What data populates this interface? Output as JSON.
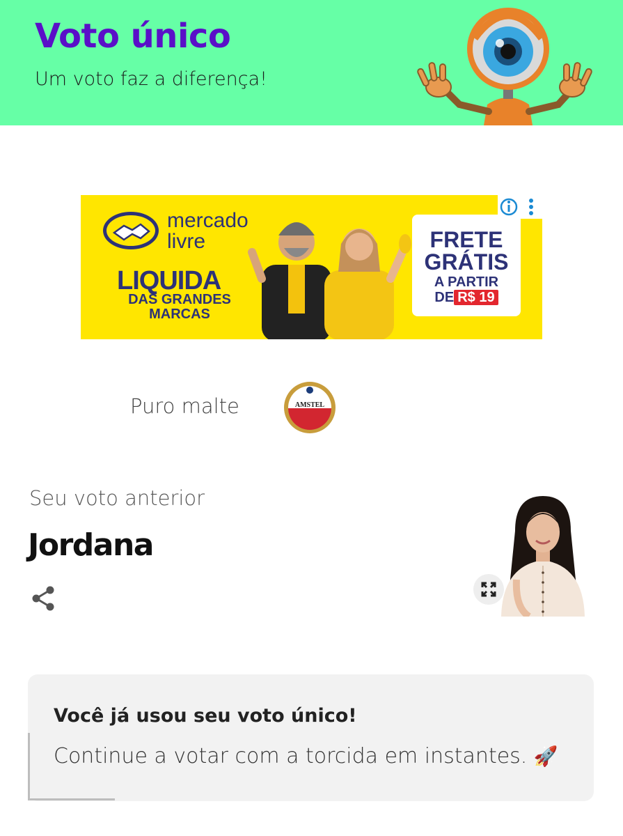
{
  "header": {
    "title": "Voto único",
    "subtitle": "Um voto faz a diferença!",
    "background_color": "#66ffa6",
    "title_color": "#5a0fc8",
    "mascot_icon": "eye-mascot-icon"
  },
  "ad": {
    "brand": "mercado livre",
    "brand_line1": "mercado",
    "brand_line2": "livre",
    "headline": "LIQUIDA",
    "subheadline_line1": "DAS GRANDES",
    "subheadline_line2": "MARCAS",
    "offer_line1": "FRETE",
    "offer_line2": "GRÁTIS",
    "offer_line3": "A PARTIR",
    "offer_prefix": "DE",
    "offer_price": "R$ 19",
    "background_color": "#ffe600",
    "text_color": "#2d3277",
    "price_color": "#e3262e"
  },
  "sponsor": {
    "text": "Puro malte",
    "logo_text": "AMSTEL"
  },
  "previous_vote": {
    "label": "Seu voto anterior",
    "name": "Jordana"
  },
  "notice": {
    "heading": "Você já usou seu voto único!",
    "message": "Continue a votar com a torcida em instantes.",
    "emoji": "🚀"
  }
}
